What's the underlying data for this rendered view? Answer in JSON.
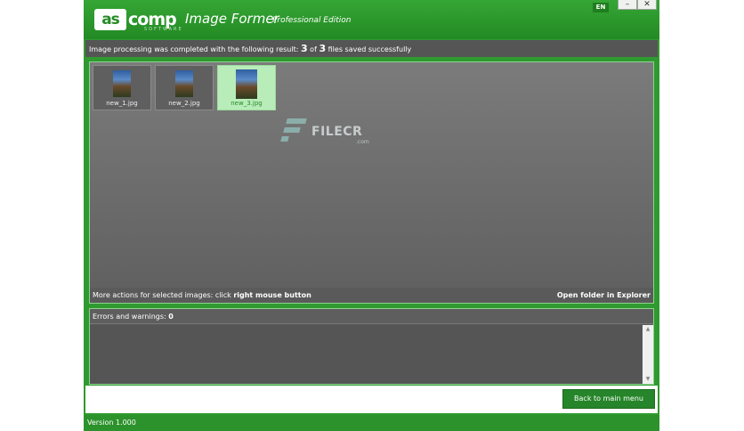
{
  "window": {
    "logo_box_text": "as",
    "logo_rest_text": "comp",
    "logo_sub_text": "SOFTWARE",
    "app_name": "Image Former",
    "edition": "Professional Edition",
    "language": "EN",
    "minimize_glyph": "–",
    "close_glyph": "✕"
  },
  "status": {
    "prefix": "Image processing was completed with the following result:",
    "saved": "3",
    "of": "of",
    "total": "3",
    "suffix": "files saved successfully"
  },
  "thumbnails": [
    {
      "label": "new_1.jpg",
      "selected": false
    },
    {
      "label": "new_2.jpg",
      "selected": false
    },
    {
      "label": "new_3.jpg",
      "selected": true
    }
  ],
  "watermark": {
    "text": "FILECR",
    "dotcom": ".com"
  },
  "gallery_footer": {
    "more_actions_prefix": "More actions for selected images: click",
    "more_actions_bold": "right mouse button",
    "open_folder": "Open folder in Explorer"
  },
  "errors": {
    "label": "Errors and warnings:",
    "count": "0"
  },
  "buttons": {
    "back": "Back to main menu"
  },
  "version": "Version 1.000",
  "colors": {
    "accent": "#2f9a2f",
    "panel": "#5a5a5a",
    "selected": "#b8ecb8"
  }
}
